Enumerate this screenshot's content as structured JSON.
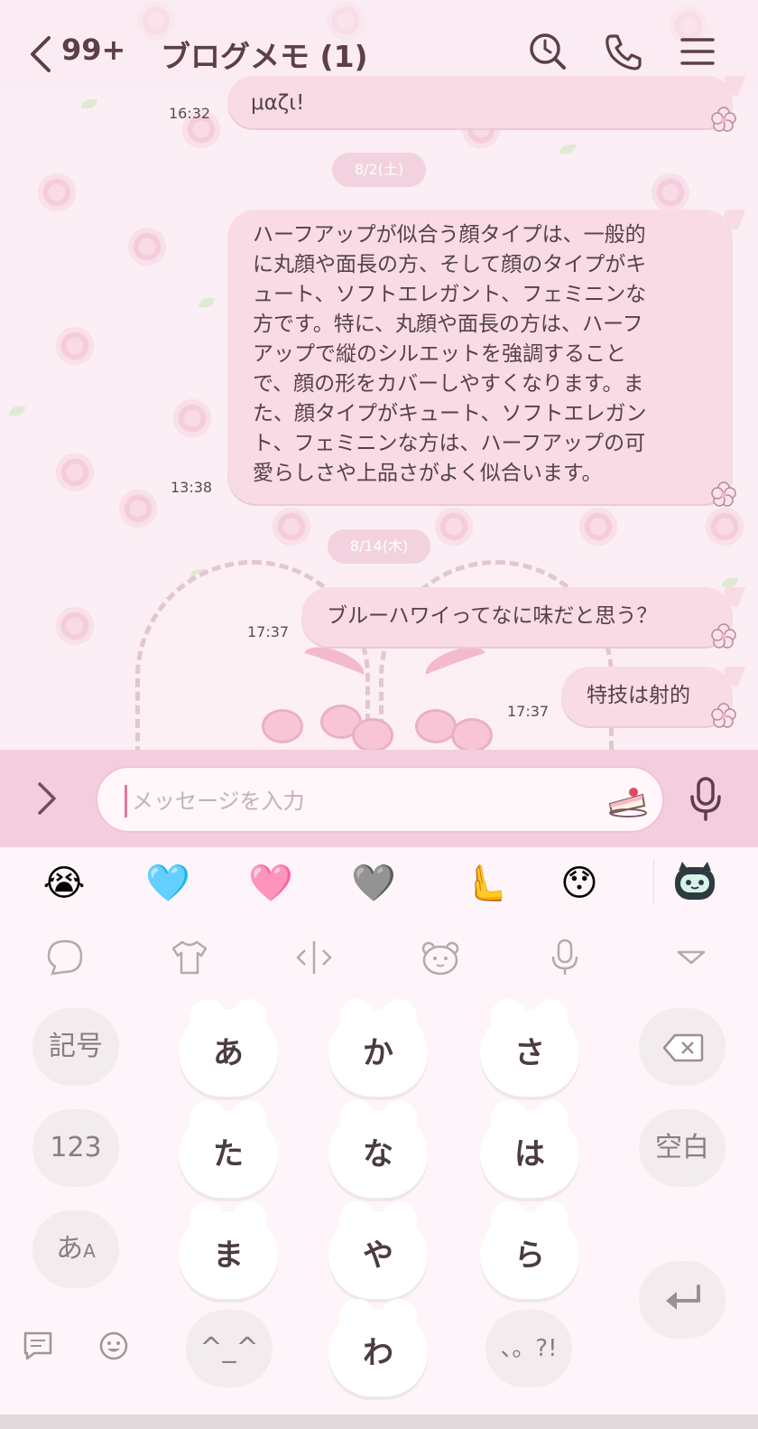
{
  "header": {
    "back_count": "99+",
    "title": "ブログメモ (1)"
  },
  "colors": {
    "bubble": "#f8dbe5",
    "accent": "#e0789c",
    "header_text": "#5d3e49"
  },
  "messages": [
    {
      "text": "μαζι!",
      "time": "16:32"
    },
    {
      "text": "ハーフアップが似合う顔タイプは、一般的\nに丸顔や面長の方、そして顔のタイプがキ\nュート、ソフトエレガント、フェミニンな\n方です。特に、丸顔や面長の方は、ハーフ\nアップで縦のシルエットを強調すること\nで、顔の形をカバーしやすくなります。ま\nた、顔タイプがキュート、ソフトエレガン\nト、フェミニンな方は、ハーフアップの可\n愛らしさや上品さがよく似合います。",
      "time": "13:38"
    },
    {
      "text": "ブルーハワイってなに味だと思う？",
      "time": "17:37"
    },
    {
      "text": "特技は射的",
      "time": "17:37"
    }
  ],
  "dates": [
    "8/2(土)",
    "8/14(木)"
  ],
  "input": {
    "placeholder": "メッセージを入力"
  },
  "keyboard": {
    "emojis": [
      "😭",
      "🩵",
      "🩷",
      "🩶",
      "🫷",
      "😯"
    ],
    "kana_keys": [
      "あ",
      "か",
      "さ",
      "た",
      "な",
      "は",
      "ま",
      "や",
      "ら",
      "わ"
    ],
    "symbols_key": "記号",
    "numbers_key": "123",
    "mode_key": "あ",
    "mode_key_sub": "A",
    "space_key": "空白",
    "face_key": "^_^",
    "punct_key": "、。?!"
  },
  "icons": [
    "back-icon",
    "search-history-icon",
    "phone-icon",
    "menu-icon",
    "expand-icon",
    "cake-icon",
    "mic-icon",
    "backspace-icon",
    "enter-icon"
  ]
}
